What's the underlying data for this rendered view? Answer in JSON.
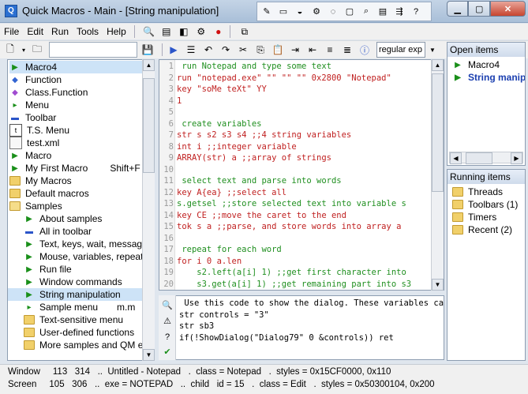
{
  "window": {
    "title": "Quick Macros - Main - [String manipulation]"
  },
  "colors": {
    "accent": "#2a6fd1",
    "selection": "#cde3f7",
    "comment": "#1f8f1f",
    "keyword": "#c02020"
  },
  "menubar": {
    "items": [
      "File",
      "Edit",
      "Run",
      "Tools",
      "Help"
    ]
  },
  "toolbar": {
    "search_mode": "regular exp"
  },
  "tree": {
    "items": [
      {
        "label": "Macro4",
        "icon": "macro-icon",
        "indent": 0,
        "selected": true
      },
      {
        "label": "Function",
        "icon": "function-icon",
        "indent": 0
      },
      {
        "label": "Class.Function",
        "icon": "class-icon",
        "indent": 0
      },
      {
        "label": "Menu",
        "icon": "menu-icon",
        "indent": 0
      },
      {
        "label": "Toolbar",
        "icon": "toolbar-icon",
        "indent": 0
      },
      {
        "label": "T.S. Menu",
        "icon": "ts-menu-icon",
        "indent": 0
      },
      {
        "label": "test.xml",
        "icon": "file-icon",
        "indent": 0
      },
      {
        "label": "Macro",
        "icon": "macro-icon",
        "indent": 0
      },
      {
        "label": "My First Macro",
        "icon": "macro-icon",
        "indent": 0,
        "hotkey": "Shift+F"
      },
      {
        "label": "My Macros",
        "icon": "folder-icon",
        "indent": 0
      },
      {
        "label": "Default macros",
        "icon": "folder-icon",
        "indent": 0
      },
      {
        "label": "Samples",
        "icon": "folder-open-icon",
        "indent": 0
      },
      {
        "label": "About samples",
        "icon": "macro-icon",
        "indent": 1
      },
      {
        "label": "All in toolbar",
        "icon": "toolbar-icon",
        "indent": 1
      },
      {
        "label": "Text, keys, wait, messages",
        "icon": "macro-icon",
        "indent": 1
      },
      {
        "label": "Mouse, variables, repeat",
        "icon": "macro-icon",
        "indent": 1
      },
      {
        "label": "Run file",
        "icon": "macro-icon",
        "indent": 1
      },
      {
        "label": "Window commands",
        "icon": "macro-icon",
        "indent": 1
      },
      {
        "label": "String manipulation",
        "icon": "macro-icon",
        "indent": 1,
        "current": true
      },
      {
        "label": "Sample menu",
        "icon": "menu-icon",
        "indent": 1,
        "hotkey": "m.m"
      },
      {
        "label": "Text-sensitive menu",
        "icon": "folder-icon",
        "indent": 1
      },
      {
        "label": "User-defined functions",
        "icon": "folder-icon",
        "indent": 1
      },
      {
        "label": "More samples and QM exte",
        "icon": "folder-icon",
        "indent": 1
      }
    ]
  },
  "editor": {
    "lines": [
      {
        "n": "1",
        "text": " run Notepad and type some text",
        "kind": "comment"
      },
      {
        "n": "2",
        "text": "run \"notepad.exe\" \"\" \"\" \"\" 0x2800 \"Notepad\"",
        "kind": "kw"
      },
      {
        "n": "3",
        "text": "key \"soMe teXt\" YY",
        "kind": "kw"
      },
      {
        "n": "4",
        "text": "1",
        "kind": "kw"
      },
      {
        "n": "5",
        "text": "",
        "kind": "plain"
      },
      {
        "n": "6",
        "text": " create variables",
        "kind": "comment"
      },
      {
        "n": "7",
        "text": "str s s2 s3 s4 ;;4 string variables",
        "kind": "kw"
      },
      {
        "n": "8",
        "text": "int i ;;integer variable",
        "kind": "kw"
      },
      {
        "n": "9",
        "text": "ARRAY(str) a ;;array of strings",
        "kind": "kw"
      },
      {
        "n": "10",
        "text": "",
        "kind": "plain"
      },
      {
        "n": "11",
        "text": " select text and parse into words",
        "kind": "comment"
      },
      {
        "n": "12",
        "text": "key A{ea} ;;select all",
        "kind": "kw"
      },
      {
        "n": "13",
        "text": "s.getsel ;;store selected text into variable s",
        "kind": "comment"
      },
      {
        "n": "14",
        "text": "key CE ;;move the caret to the end",
        "kind": "kw"
      },
      {
        "n": "15",
        "text": "tok s a ;;parse, and store words into array a",
        "kind": "kw"
      },
      {
        "n": "16",
        "text": "",
        "kind": "plain"
      },
      {
        "n": "17",
        "text": " repeat for each word",
        "kind": "comment"
      },
      {
        "n": "18",
        "text": "for i 0 a.len",
        "kind": "kw"
      },
      {
        "n": "19",
        "text": "    s2.left(a[i] 1) ;;get first character into",
        "kind": "comment"
      },
      {
        "n": "20",
        "text": "    s3.get(a[i] 1) ;;get remaining part into s3",
        "kind": "comment"
      }
    ]
  },
  "output": {
    "lines": [
      " Use this code to show the dialog. These variables can be us",
      "str controls = \"3\"",
      "str sb3",
      "if(!ShowDialog(\"Dialog79\" 0 &controls)) ret"
    ]
  },
  "open_items": {
    "title": "Open items",
    "items": [
      {
        "label": "Macro4",
        "bold": false
      },
      {
        "label": "String manip",
        "bold": true
      }
    ]
  },
  "running_items": {
    "title": "Running items",
    "items": [
      "Threads",
      "Toolbars (1)",
      "Timers",
      "Recent (2)"
    ]
  },
  "status": {
    "window_line": "Window     113   314   ..  Untitled - Notepad   .  class = Notepad   .  styles = 0x15CF0000, 0x110",
    "screen_line": "Screen     105   306   ..  exe = NOTEPAD   ..  child   id = 15   .  class = Edit   .  styles = 0x50300104, 0x200"
  }
}
